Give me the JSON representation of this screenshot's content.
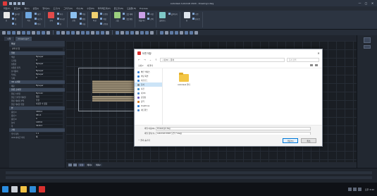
{
  "app": {
    "title": "Autodesk AutoCAD 2020 - Drawing1.dwg"
  },
  "window_buttons": [
    "—",
    "▢",
    "✕"
  ],
  "menu": [
    "파일(F)",
    "편집(E)",
    "뷰(V)",
    "삽입(I)",
    "형식(O)",
    "도구(T)",
    "그리기(D)",
    "치수(N)",
    "수정(M)",
    "파라메트릭(P)",
    "윈도우(W)",
    "도움말(H)",
    "Express"
  ],
  "ribbon": {
    "groups": [
      {
        "big": "선",
        "small": [
          "폴리선",
          "원",
          "호"
        ]
      },
      {
        "big": "이동",
        "small": [
          "회전",
          "자르기",
          "복사"
        ]
      },
      {
        "big": "문자",
        "small": [
          "치수",
          "지시선",
          "표"
        ]
      },
      {
        "big": "삽입",
        "small": [
          "작성",
          "편집",
          "속성"
        ]
      },
      {
        "big": "특성",
        "small": [
          "도면층",
          "색상",
          "선종류"
        ]
      },
      {
        "big": "그룹",
        "small": [
          "그룹 해제",
          "그룹 편집"
        ]
      },
      {
        "big": "유틸리티",
        "small": [
          "측정",
          "선택"
        ]
      },
      {
        "big": "클립보드",
        "small": [
          "붙여넣기"
        ]
      },
      {
        "big": "뷰",
        "small": [
          "기준",
          "뷰포트"
        ]
      }
    ]
  },
  "tabs": [
    "시작",
    "Drawing1*"
  ],
  "properties": {
    "header": "특성",
    "selector": "선택 안 함",
    "sections": [
      {
        "title": "일반",
        "rows": [
          [
            "색상",
            "ByLayer"
          ],
          [
            "도면층",
            "0"
          ],
          [
            "선종류",
            "ByLayer"
          ],
          [
            "선종류 축척",
            "1"
          ],
          [
            "선가중치",
            "ByLayer"
          ],
          [
            "투명도",
            "ByLayer"
          ],
          [
            "두께",
            "0"
          ]
        ]
      },
      {
        "title": "3D 시각화",
        "rows": [
          [
            "재료",
            "ByLayer"
          ]
        ]
      },
      {
        "title": "플롯 스타일",
        "rows": [
          [
            "플롯 스타일",
            "ByColor"
          ],
          [
            "플롯 스타일 테이블",
            "없음"
          ],
          [
            "플롯 테이블 부착",
            "모형"
          ],
          [
            "플롯 테이블 유형",
            "사용할 수 없음"
          ]
        ]
      },
      {
        "title": "뷰",
        "rows": [
          [
            "중심 X",
            "1800.2"
          ],
          [
            "중심 Y",
            "961.4"
          ],
          [
            "중심 Z",
            "0"
          ],
          [
            "높이",
            "1483.6"
          ],
          [
            "폭",
            "3018.3"
          ]
        ]
      },
      {
        "title": "기타",
        "rows": [
          [
            "주석 축척",
            "1:1"
          ],
          [
            "UCS 아이콘 켜기",
            "예"
          ]
        ]
      }
    ]
  },
  "canvas_bar": {
    "tabs": [
      "모형",
      "배치1",
      "배치2"
    ]
  },
  "dialog": {
    "title": "도면 저장",
    "address": "› 내 PC › 문서",
    "search_placeholder": "문서 검색",
    "commands": [
      "구성 ▾",
      "새 폴더"
    ],
    "nav_items": [
      {
        "label": "빠른 액세스",
        "color": "#3b83d6",
        "selected": false
      },
      {
        "label": "바탕 화면",
        "color": "#2f7ed8",
        "selected": false
      },
      {
        "label": "다운로드",
        "color": "#2f7ed8",
        "selected": false
      },
      {
        "label": "문서",
        "color": "#8a8a8a",
        "selected": true
      },
      {
        "label": "사진",
        "color": "#3f8ec7",
        "selected": false
      },
      {
        "label": "내 PC",
        "color": "#4a86c8",
        "selected": false
      },
      {
        "label": "동영상",
        "color": "#6d5dbd",
        "selected": false
      },
      {
        "label": "음악",
        "color": "#d07a2a",
        "selected": false
      },
      {
        "label": "OneDrive",
        "color": "#2f7ed8",
        "selected": false
      },
      {
        "label": "네트워크",
        "color": "#4a86c8",
        "selected": false
      }
    ],
    "folder_label": "Autodesk 폴더",
    "filename_label": "파일 이름(N):",
    "filename_value": "Drawing1.dwg",
    "filetype_label": "파일 형식(T):",
    "filetype_value": "AutoCAD 2018 도면 (*.dwg)",
    "hide_folders": "⌃ 폴더 숨기기",
    "save_button": "저장(S)",
    "cancel_button": "취소"
  },
  "taskbar": {
    "icons": [
      {
        "name": "start-icon",
        "color": "#2b8de0"
      },
      {
        "name": "search-icon",
        "color": "#c9ced6"
      },
      {
        "name": "explorer-icon",
        "color": "#f2c245"
      },
      {
        "name": "edge-icon",
        "color": "#2f8bd6"
      },
      {
        "name": "autocad-icon",
        "color": "#d9302f"
      }
    ],
    "clock": "오후 3:42"
  }
}
